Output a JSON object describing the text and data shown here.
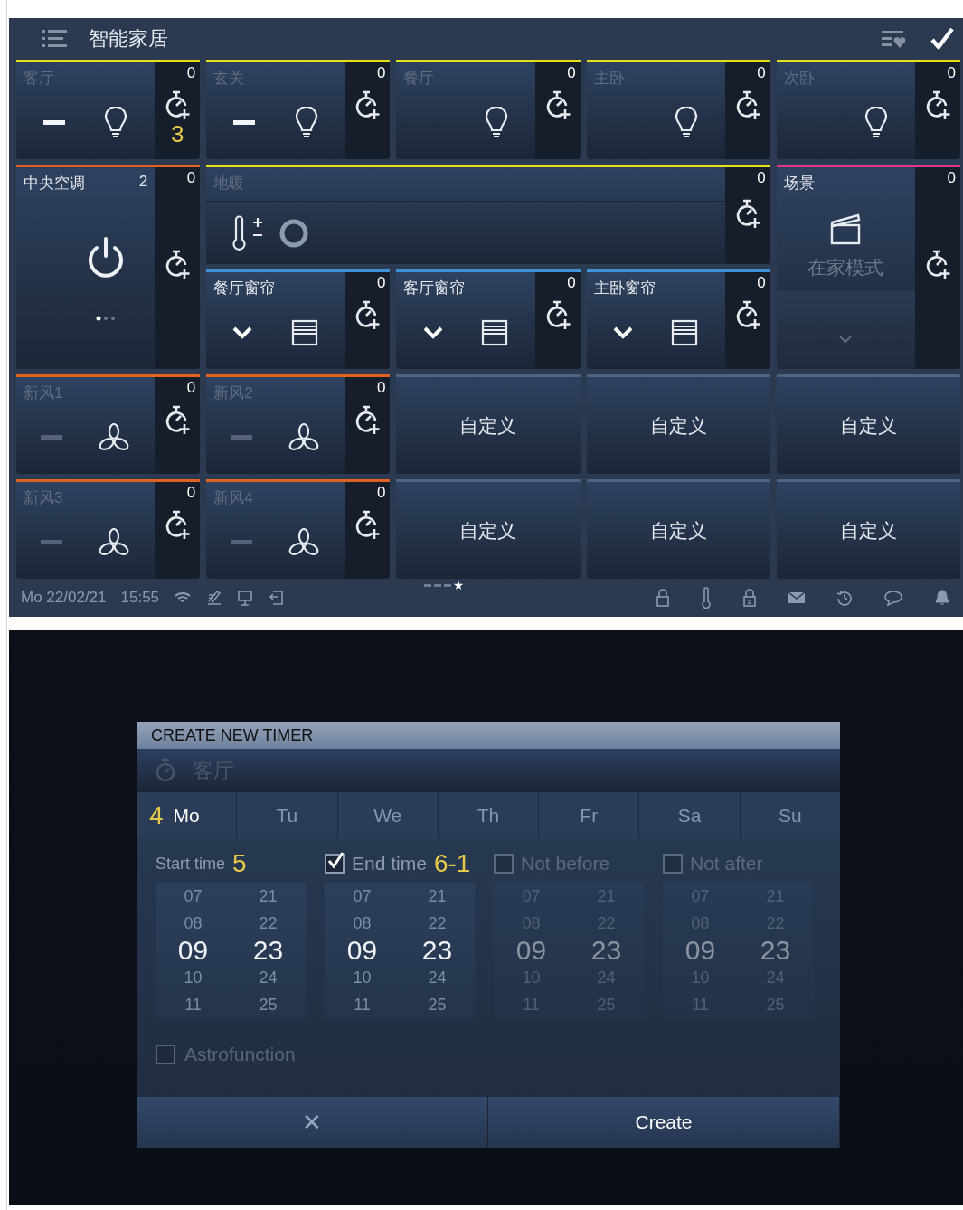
{
  "home_screen": {
    "header": {
      "title": "智能家居"
    },
    "tiles": [
      {
        "kind": "light",
        "title": "客厅",
        "active": false,
        "color": "#e6e01a",
        "count": "0",
        "minus": true,
        "annotation": "3"
      },
      {
        "kind": "light",
        "title": "玄关",
        "active": false,
        "color": "#e6e01a",
        "count": "0",
        "minus": true
      },
      {
        "kind": "light",
        "title": "餐厅",
        "active": false,
        "color": "#e6e01a",
        "count": "0",
        "minus": false
      },
      {
        "kind": "light",
        "title": "主卧",
        "active": false,
        "color": "#e6e01a",
        "count": "0",
        "minus": false
      },
      {
        "kind": "light",
        "title": "次卧",
        "active": false,
        "color": "#e6e01a",
        "count": "0",
        "minus": false
      },
      {
        "kind": "ac",
        "title": "中央空调",
        "active": true,
        "color": "#e0621e",
        "count": "0",
        "value": "2"
      },
      {
        "kind": "floor",
        "title": "地暖",
        "active": false,
        "color": "#e6e01a",
        "count": "0"
      },
      {
        "kind": "scene",
        "title": "场景",
        "active": true,
        "color": "#e0368c",
        "count": "0",
        "scene": "在家模式"
      },
      {
        "kind": "curtain",
        "title": "餐厅窗帘",
        "active": true,
        "color": "#3f8fd6",
        "count": "0"
      },
      {
        "kind": "curtain",
        "title": "客厅窗帘",
        "active": true,
        "color": "#3f8fd6",
        "count": "0"
      },
      {
        "kind": "curtain",
        "title": "主卧窗帘",
        "active": true,
        "color": "#3f8fd6",
        "count": "0"
      },
      {
        "kind": "fan",
        "title": "新风1",
        "active": false,
        "color": "#e0621e",
        "count": "0",
        "minus": true
      },
      {
        "kind": "fan",
        "title": "新风2",
        "active": false,
        "color": "#e0621e",
        "count": "0",
        "minus": true
      },
      {
        "kind": "custom",
        "title": "自定义",
        "color": "#4d6480"
      },
      {
        "kind": "custom",
        "title": "自定义",
        "color": "#4d6480"
      },
      {
        "kind": "custom",
        "title": "自定义",
        "color": "#4d6480"
      },
      {
        "kind": "fan",
        "title": "新风3",
        "active": false,
        "color": "#e0621e",
        "count": "0",
        "minus": true
      },
      {
        "kind": "fan",
        "title": "新风4",
        "active": false,
        "color": "#e0621e",
        "count": "0",
        "minus": true
      },
      {
        "kind": "custom",
        "title": "自定义",
        "color": "#4d6480"
      },
      {
        "kind": "custom",
        "title": "自定义",
        "color": "#4d6480"
      },
      {
        "kind": "custom",
        "title": "自定义",
        "color": "#4d6480"
      }
    ],
    "pages": [
      {
        "selected": false
      },
      {
        "selected": false
      },
      {
        "selected": false
      },
      {
        "selected": true
      }
    ],
    "status_bar": {
      "date": "Mo 22/02/21",
      "time": "15:55"
    }
  },
  "timer_dialog": {
    "title": "CREATE NEW TIMER",
    "target": "客厅",
    "day_annotation": "4",
    "days": [
      {
        "label": "Mo",
        "selected": true
      },
      {
        "label": "Tu",
        "selected": false
      },
      {
        "label": "We",
        "selected": false
      },
      {
        "label": "Th",
        "selected": false
      },
      {
        "label": "Fr",
        "selected": false
      },
      {
        "label": "Sa",
        "selected": false
      },
      {
        "label": "Su",
        "selected": false
      }
    ],
    "pickers": [
      {
        "kind": "plain",
        "label": "Start time",
        "annotation": "5",
        "enabled": true,
        "hours": [
          {
            "v": "07",
            "selected": false
          },
          {
            "v": "08",
            "selected": false
          },
          {
            "v": "09",
            "selected": true
          },
          {
            "v": "10",
            "selected": false
          },
          {
            "v": "11",
            "selected": false
          }
        ],
        "minutes": [
          {
            "v": "21",
            "selected": false
          },
          {
            "v": "22",
            "selected": false
          },
          {
            "v": "23",
            "selected": true
          },
          {
            "v": "24",
            "selected": false
          },
          {
            "v": "25",
            "selected": false
          }
        ]
      },
      {
        "kind": "checkbox",
        "label": "End time",
        "annotation": "6-1",
        "checked": true,
        "enabled": true,
        "hours": [
          {
            "v": "07",
            "selected": false
          },
          {
            "v": "08",
            "selected": false
          },
          {
            "v": "09",
            "selected": true
          },
          {
            "v": "10",
            "selected": false
          },
          {
            "v": "11",
            "selected": false
          }
        ],
        "minutes": [
          {
            "v": "21",
            "selected": false
          },
          {
            "v": "22",
            "selected": false
          },
          {
            "v": "23",
            "selected": true
          },
          {
            "v": "24",
            "selected": false
          },
          {
            "v": "25",
            "selected": false
          }
        ]
      },
      {
        "kind": "checkbox",
        "label": "Not before",
        "checked": false,
        "enabled": false,
        "hours": [
          {
            "v": "07",
            "selected": false
          },
          {
            "v": "08",
            "selected": false
          },
          {
            "v": "09",
            "selected": true
          },
          {
            "v": "10",
            "selected": false
          },
          {
            "v": "11",
            "selected": false
          }
        ],
        "minutes": [
          {
            "v": "21",
            "selected": false
          },
          {
            "v": "22",
            "selected": false
          },
          {
            "v": "23",
            "selected": true
          },
          {
            "v": "24",
            "selected": false
          },
          {
            "v": "25",
            "selected": false
          }
        ]
      },
      {
        "kind": "checkbox",
        "label": "Not after",
        "checked": false,
        "enabled": false,
        "hours": [
          {
            "v": "07",
            "selected": false
          },
          {
            "v": "08",
            "selected": false
          },
          {
            "v": "09",
            "selected": true
          },
          {
            "v": "10",
            "selected": false
          },
          {
            "v": "11",
            "selected": false
          }
        ],
        "minutes": [
          {
            "v": "21",
            "selected": false
          },
          {
            "v": "22",
            "selected": false
          },
          {
            "v": "23",
            "selected": true
          },
          {
            "v": "24",
            "selected": false
          },
          {
            "v": "25",
            "selected": false
          }
        ]
      }
    ],
    "astro": {
      "label": "Astrofunction",
      "checked": false,
      "enabled": false
    },
    "cancel_button": "✕",
    "create_button": "Create"
  }
}
